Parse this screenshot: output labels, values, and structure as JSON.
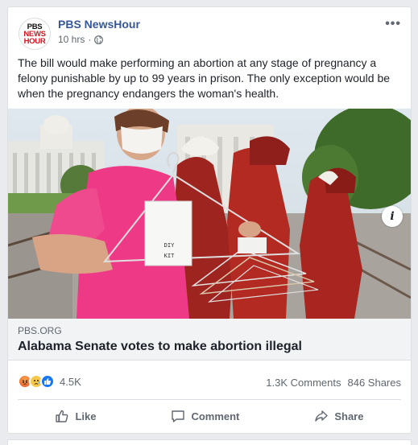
{
  "post": {
    "page_name": "PBS NewsHour",
    "avatar_lines": [
      "PBS",
      "NEWS",
      "HOUR"
    ],
    "time": "10 hrs",
    "audience_icon": "globe-icon",
    "more_icon": "more-options-icon",
    "text": "The bill would make performing an abortion at any stage of pregnancy a felony punishable by up to 99 years in prison. The only exception would be when the pregnancy endangers the woman's health."
  },
  "photo": {
    "sign_text_1": "DIY",
    "sign_text_2": "KIT"
  },
  "link": {
    "domain": "PBS.ORG",
    "title": "Alabama Senate votes to make abortion illegal",
    "info_glyph": "i"
  },
  "engagement": {
    "reaction_count": "4.5K",
    "comments": "1.3K Comments",
    "shares": "846 Shares"
  },
  "actions": {
    "like": "Like",
    "comment": "Comment",
    "share": "Share"
  },
  "colors": {
    "brand_link": "#365899",
    "pbs_red": "#d7131d",
    "like_blue": "#1877f2"
  }
}
